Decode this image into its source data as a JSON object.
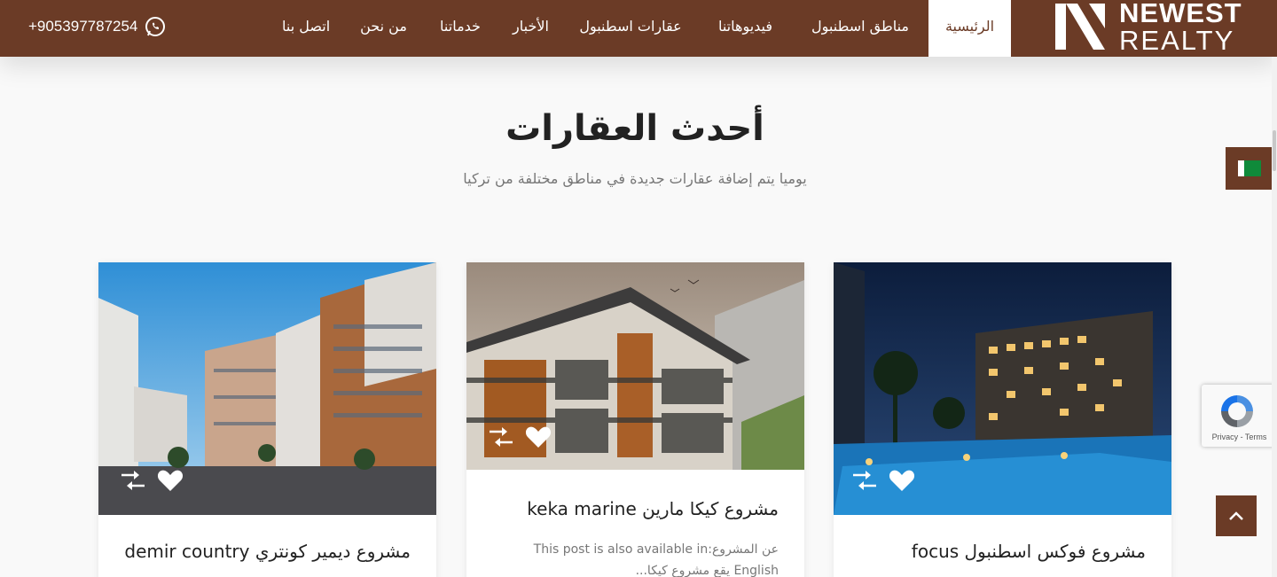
{
  "header": {
    "phone": "+905397787254",
    "nav": [
      "الرئيسية",
      "مناطق اسطنبول",
      "فيديوهاتنا",
      "عقارات اسطنبول",
      "الأخبار",
      "خدماتنا",
      "من نحن",
      "اتصل بنا"
    ],
    "logo_top": "NEWEST",
    "logo_bottom": "REALTY",
    "brand_color": "#6b3b26"
  },
  "section": {
    "title": "أحدث العقارات",
    "subtitle": "يوميا يتم إضافة عقارات جديدة في مناطق مختلفة من تركيا"
  },
  "cards": [
    {
      "title": "مشروع فوكس اسطنبول focus",
      "excerpt": ""
    },
    {
      "title": "مشروع كيكا مارين keka marine",
      "excerpt": "عن المشروعThis post is also available in: English يقع مشروع كيكا..."
    },
    {
      "title": "مشروع ديمير كونتري demir country",
      "excerpt": ""
    }
  ],
  "recaptcha": {
    "text": "Privacy - Terms"
  },
  "icons": {
    "phone": "whatsapp-icon",
    "compare": "compare-arrows-icon",
    "favorite": "heart-icon",
    "back_to_top": "chevron-up-icon",
    "language": "flag-icon"
  }
}
